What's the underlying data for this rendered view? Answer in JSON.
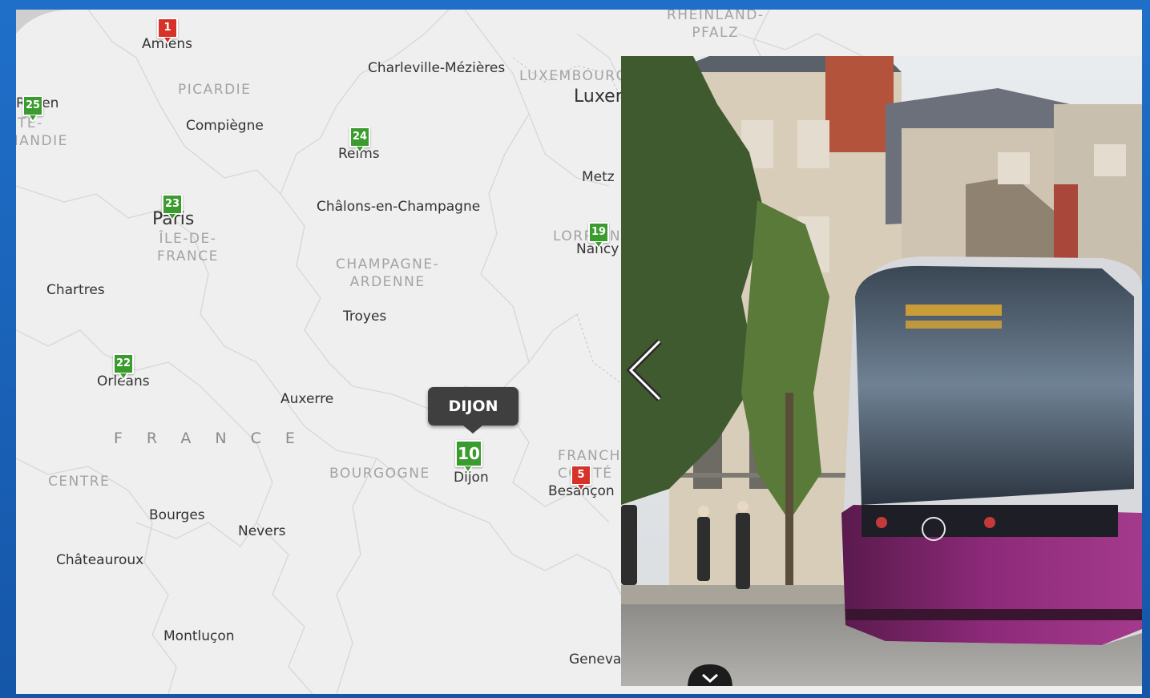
{
  "map": {
    "cities": {
      "amiens": "Amiens",
      "rouen": "Rouen",
      "charleville": "Charleville-Mézières",
      "compiegne": "Compiègne",
      "reims": "Reims",
      "metz": "Metz",
      "paris": "Paris",
      "chalons": "Châlons-en-Champagne",
      "nancy": "Nancy",
      "chartres": "Chartres",
      "troyes": "Troyes",
      "orleans": "Orléans",
      "auxerre": "Auxerre",
      "dijon": "Dijon",
      "besancon": "Besançon",
      "bourges": "Bourges",
      "nevers": "Nevers",
      "chateauroux": "Châteauroux",
      "montlucon": "Montluçon",
      "geneva": "Geneva",
      "luxembourg_city": "Luxem"
    },
    "regions": {
      "rheinland": "RHEINLAND-\nPFALZ",
      "picardie": "PICARDIE",
      "normandie": "UTE-\nMANDIE",
      "luxembourg": "LUXEMBOURG",
      "ile_de_france": "ÎLE-DE-\nFRANCE",
      "champagne": "CHAMPAGNE-\nARDENNE",
      "lorraine": "LORRAIN",
      "bourgogne": "BOURGOGNE",
      "centre": "CENTRE",
      "franche_comte": "FRANCHE-\nCOMTÉ"
    },
    "country": "FRANCE",
    "markers": [
      {
        "id": "1",
        "color": "#d6322a",
        "city": "Amiens"
      },
      {
        "id": "25",
        "color": "#3a9b2e",
        "city": "Rouen"
      },
      {
        "id": "24",
        "color": "#3a9b2e",
        "city": "Reims"
      },
      {
        "id": "23",
        "color": "#3a9b2e",
        "city": "Paris"
      },
      {
        "id": "19",
        "color": "#3a9b2e",
        "city": "Nancy"
      },
      {
        "id": "22",
        "color": "#3a9b2e",
        "city": "Orléans"
      },
      {
        "id": "10",
        "color": "#3a9b2e",
        "city": "Dijon"
      },
      {
        "id": "5",
        "color": "#d6322a",
        "city": "Besançon"
      }
    ],
    "tooltip": "DIJON"
  },
  "photo": {
    "subject": "purple tram in Dijon street",
    "prev_icon": "chevron-left-icon",
    "down_icon": "chevron-down-icon"
  }
}
